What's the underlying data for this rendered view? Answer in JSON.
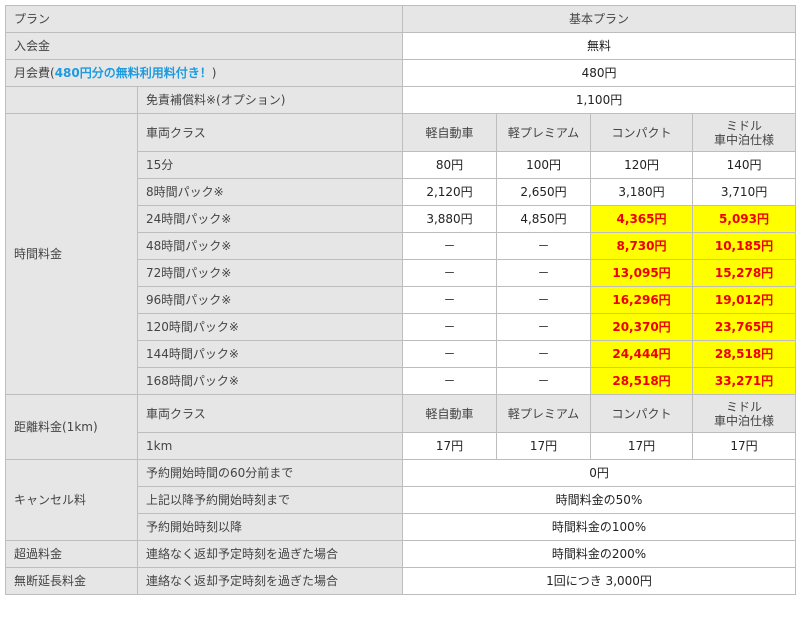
{
  "header": {
    "plan_label": "プラン",
    "plan_name": "基本プラン"
  },
  "admission": {
    "label": "入会金",
    "value": "無料"
  },
  "monthly": {
    "label": "月会費(",
    "note": "480円分の無料利用料付き！",
    "close": ")",
    "value": "480円"
  },
  "insurance": {
    "label": "免責補償料※(オプション)",
    "value": "1,100円"
  },
  "time_fee": {
    "label": "時間料金",
    "class_label": "車両クラス",
    "classes": [
      "軽自動車",
      "軽プレミアム",
      "コンパクト",
      "ミドル",
      "車中泊仕様"
    ],
    "rows": [
      {
        "name": "15分",
        "kei": "80円",
        "kei_premium": "100円",
        "compact": "120円",
        "middle": "140円"
      },
      {
        "name": "8時間パック※",
        "kei": "2,120円",
        "kei_premium": "2,650円",
        "compact": "3,180円",
        "middle": "3,710円"
      },
      {
        "name": "24時間パック※",
        "kei": "3,880円",
        "kei_premium": "4,850円",
        "compact": "4,365円",
        "middle": "5,093円"
      },
      {
        "name": "48時間パック※",
        "kei": "－",
        "kei_premium": "－",
        "compact": "8,730円",
        "middle": "10,185円"
      },
      {
        "name": "72時間パック※",
        "kei": "－",
        "kei_premium": "－",
        "compact": "13,095円",
        "middle": "15,278円"
      },
      {
        "name": "96時間パック※",
        "kei": "－",
        "kei_premium": "－",
        "compact": "16,296円",
        "middle": "19,012円"
      },
      {
        "name": "120時間パック※",
        "kei": "－",
        "kei_premium": "－",
        "compact": "20,370円",
        "middle": "23,765円"
      },
      {
        "name": "144時間パック※",
        "kei": "－",
        "kei_premium": "－",
        "compact": "24,444円",
        "middle": "28,518円"
      },
      {
        "name": "168時間パック※",
        "kei": "－",
        "kei_premium": "－",
        "compact": "28,518円",
        "middle": "33,271円"
      }
    ]
  },
  "distance_fee": {
    "label": "距離料金(1km)",
    "class_label": "車両クラス",
    "unit": "1km",
    "kei": "17円",
    "kei_premium": "17円",
    "compact": "17円",
    "middle": "17円"
  },
  "cancel": {
    "label": "キャンセル料",
    "rows": [
      {
        "name": "予約開始時間の60分前まで",
        "value": "0円"
      },
      {
        "name": "上記以降予約開始時刻まで",
        "value": "時間料金の50%"
      },
      {
        "name": "予約開始時刻以降",
        "value": "時間料金の100%"
      }
    ]
  },
  "overtime": {
    "label": "超過料金",
    "condition": "連絡なく返却予定時刻を過ぎた場合",
    "value": "時間料金の200%"
  },
  "no_extension": {
    "label": "無断延長料金",
    "condition": "連絡なく返却予定時刻を過ぎた場合",
    "value": "1回につき 3,000円"
  },
  "colors": {
    "highlight_bg": "#ffff00",
    "highlight_text": "#ee0000",
    "accent_blue": "#1e9be0",
    "label_bg": "#e6e6e6"
  }
}
